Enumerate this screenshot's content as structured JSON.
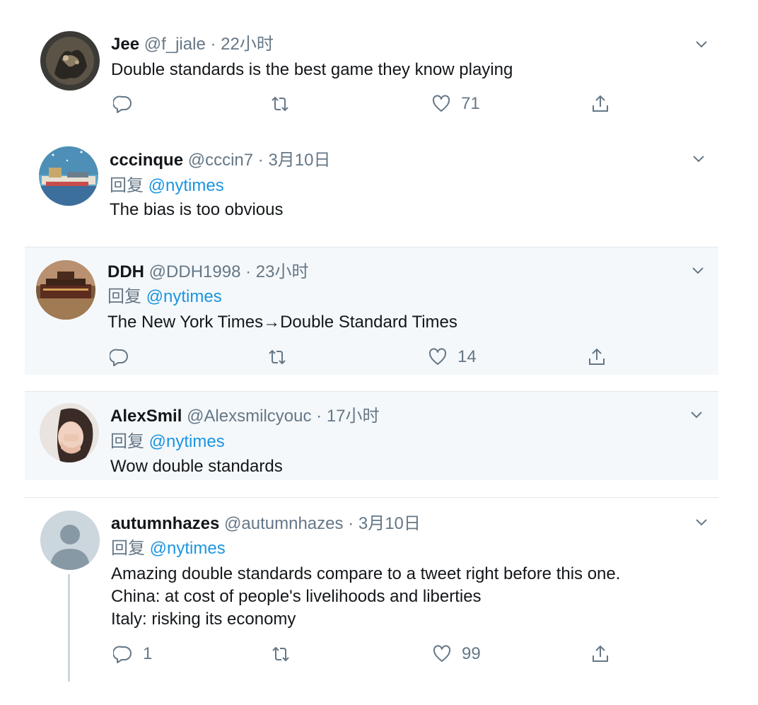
{
  "tweets": [
    {
      "name": "Jee",
      "handle": "@f_jiale",
      "sep": "·",
      "time": "22小时",
      "reply_prefix": "",
      "reply_to": "",
      "lines": [
        "Double standards is the best game they know playing"
      ],
      "actions": {
        "reply": "",
        "retweet": "",
        "like": "71"
      },
      "highlighted": false
    },
    {
      "name": "cccinque",
      "handle": "@cccin7",
      "sep": "·",
      "time": "3月10日",
      "reply_prefix": "回复",
      "reply_to": "@nytimes",
      "lines": [
        "The bias is too obvious"
      ],
      "highlighted": false
    },
    {
      "name": "DDH",
      "handle": "@DDH1998",
      "sep": "·",
      "time": "23小时",
      "reply_prefix": "回复",
      "reply_to": "@nytimes",
      "lines": [
        "The New York Times→Double Standard Times"
      ],
      "actions": {
        "reply": "",
        "retweet": "",
        "like": "14"
      },
      "highlighted": true
    },
    {
      "name": "AlexSmil",
      "handle": "@Alexsmilcyouc",
      "sep": "·",
      "time": "17小时",
      "reply_prefix": "回复",
      "reply_to": "@nytimes",
      "lines": [
        "Wow double standards"
      ],
      "highlighted": true
    },
    {
      "name": "autumnhazes",
      "handle": "@autumnhazes",
      "sep": "·",
      "time": "3月10日",
      "reply_prefix": "回复",
      "reply_to": "@nytimes",
      "lines": [
        "Amazing double standards compare to a tweet right before this one.",
        "China: at cost of people's livelihoods and liberties",
        "Italy: risking its economy"
      ],
      "actions": {
        "reply": "1",
        "retweet": "",
        "like": "99"
      },
      "highlighted": false
    }
  ],
  "colors": {
    "name": "#14171a",
    "muted": "#657786",
    "mention": "#1b95e0",
    "highlight_bg": "#f5f8fa",
    "border": "#e1e8ed"
  },
  "icons": {
    "reply": "reply-icon",
    "retweet": "retweet-icon",
    "like": "like-icon",
    "share": "share-icon",
    "menu": "chevron-down-icon"
  }
}
